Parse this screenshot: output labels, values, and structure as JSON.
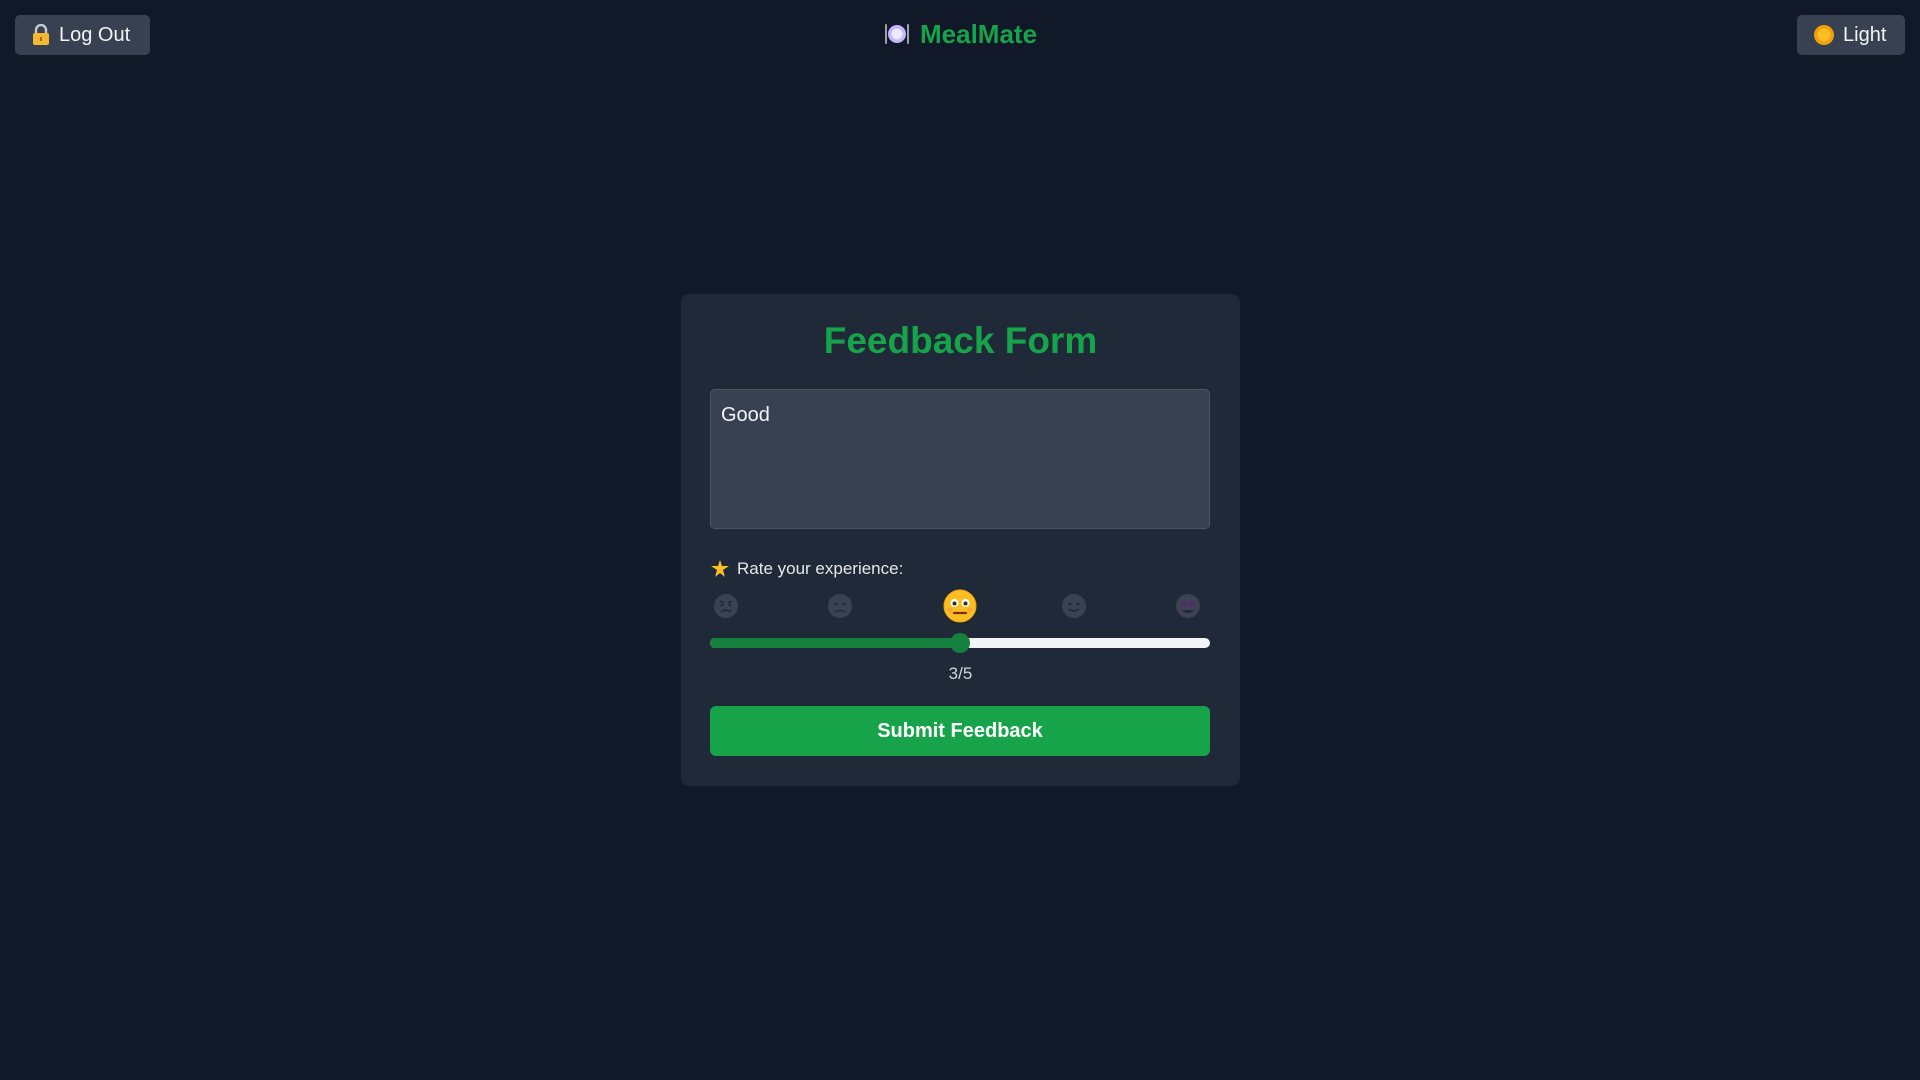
{
  "header": {
    "logout_label": "Log Out",
    "logout_icon": "lock-icon",
    "brand_name": "MealMate",
    "brand_icon": "plate-cutlery-icon",
    "theme_label": "Light",
    "theme_icon": "sun-icon"
  },
  "form": {
    "title": "Feedback Form",
    "feedback_text": "Good",
    "rate_label": "Rate your experience:",
    "rate_icon": "sparkle-icon",
    "emojis": [
      "angry-face-icon",
      "sad-face-icon",
      "neutral-face-icon",
      "smiling-face-icon",
      "star-eyes-face-icon"
    ],
    "rating": 3,
    "rating_max": 5,
    "rating_display": "3/5",
    "submit_label": "Submit Feedback"
  },
  "colors": {
    "background": "#111827",
    "card": "#1f2937",
    "accent": "#16a34a",
    "button_dark": "#374151"
  }
}
